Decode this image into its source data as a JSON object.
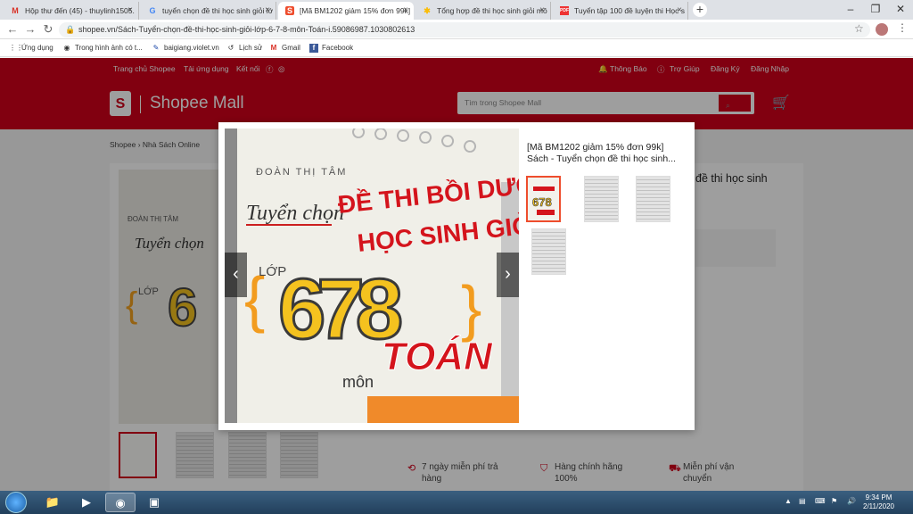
{
  "browser": {
    "tabs": [
      {
        "icon": "gmail-icon",
        "glyph": "M",
        "label": "Hộp thư đến (45) - thuylinh1505."
      },
      {
        "icon": "google-icon",
        "glyph": "G",
        "label": "tuyển chọn đề thi học sinh giỏi lớ"
      },
      {
        "icon": "shopee-icon",
        "glyph": "S",
        "label": "[Mã BM1202 giảm 15% đơn 99k]"
      },
      {
        "icon": "google-photos-icon",
        "glyph": "✱",
        "label": "Tổng hợp đề thi học sinh giỏi mô"
      },
      {
        "icon": "pdf-icon",
        "glyph": "PDF",
        "label": "Tuyển tập 100 đề luyện thi Học s"
      }
    ],
    "url": "shopee.vn/Sách-Tuyển-chọn-đề-thi-học-sinh-giỏi-lớp-6-7-8-môn-Toán-i.59086987.1030802613",
    "bookmarks": [
      {
        "icon": "apps-icon",
        "label": "Ứng dụng"
      },
      {
        "icon": "globe-icon",
        "label": "Trong hình ảnh có t..."
      },
      {
        "icon": "violet-icon",
        "label": "baigiang.violet.vn"
      },
      {
        "icon": "history-icon",
        "label": "Lịch sử"
      },
      {
        "icon": "gmail-icon",
        "label": "Gmail"
      },
      {
        "icon": "facebook-icon",
        "label": "Facebook"
      }
    ]
  },
  "shopee": {
    "top_links": {
      "seller_centre": "Trang chủ Shopee",
      "download": "Tải ứng dụng",
      "connect": "Kết nối",
      "notifications": "Thông Báo",
      "help": "Trợ Giúp",
      "register": "Đăng Ký",
      "login": "Đăng Nhập"
    },
    "logo_text": "Shopee Mall",
    "search_placeholder": "Tìm trong Shopee Mall",
    "breadcrumb": [
      "Shopee",
      "Nhà Sách Online"
    ],
    "background_title": "đề thi học sinh",
    "features": [
      {
        "line1": "7 ngày miễn phí trả",
        "line2": "hàng"
      },
      {
        "line1": "Hàng chính hãng",
        "line2": "100%"
      },
      {
        "line1": "Miễn phí vận",
        "line2": "chuyển"
      }
    ]
  },
  "modal": {
    "title_line1": "[Mã BM1202 giảm 15% đơn 99k]",
    "title_line2": "Sách - Tuyển chọn đề thi học sinh...",
    "cover": {
      "author": "ĐOÀN THỊ TÂM",
      "line1": "Tuyển chọn",
      "line2": "ĐỀ THI BỒI DƯỠNG",
      "line3": "HỌC SINH GIỎI",
      "grade_label": "LỚP",
      "numbers": "678",
      "subject_prefix": "môn",
      "subject": "TOÁN"
    },
    "prev_glyph": "‹",
    "next_glyph": "›"
  },
  "taskbar": {
    "time": "9:34 PM",
    "date": "2/11/2020"
  },
  "colors": {
    "brand": "#d0011b",
    "accent": "#ee4d2d"
  }
}
